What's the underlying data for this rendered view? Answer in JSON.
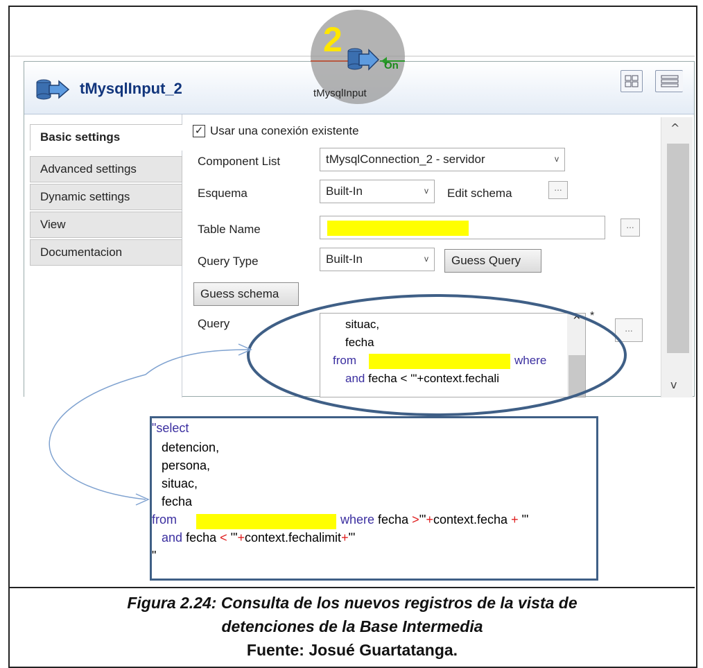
{
  "component": {
    "title": "tMysqlInput_2",
    "badge_number": "2",
    "badge_label": "tMysqlInput",
    "badge_connector": "On"
  },
  "tabs": [
    {
      "label": "Basic settings",
      "active": true
    },
    {
      "label": "Advanced settings",
      "active": false
    },
    {
      "label": "Dynamic settings",
      "active": false
    },
    {
      "label": "View",
      "active": false
    },
    {
      "label": "Documentacion",
      "active": false
    }
  ],
  "settings": {
    "use_existing_connection": {
      "label": "Usar una conexión existente",
      "checked": true
    },
    "component_list": {
      "label": "Component List",
      "value": "tMysqlConnection_2 - servidor"
    },
    "schema": {
      "label": "Esquema",
      "value": "Built-In",
      "edit_label": "Edit schema"
    },
    "table_name": {
      "label": "Table Name",
      "value": ""
    },
    "query_type": {
      "label": "Query Type",
      "value": "Built-In",
      "guess_query_label": "Guess Query"
    },
    "guess_schema_label": "Guess schema",
    "query": {
      "label": "Query",
      "modified_marker": "*",
      "visible_lines": [
        "situac,",
        "fecha",
        "from",
        "where",
        "and",
        "fecha",
        "< '\"+context.fechali"
      ]
    },
    "dots_label": "..."
  },
  "zoomed_query": {
    "lines": [
      "\"select",
      "detencion,",
      "persona,",
      "situac,",
      "fecha"
    ],
    "from_kw": "from",
    "where_kw": "where",
    "where_rest": "fecha",
    "where_op1": ">",
    "where_str1": "'\"",
    "where_op2": "+",
    "where_ctx": "context.fecha",
    "where_op3": "+",
    "where_str2": "\"'",
    "and_kw": "and",
    "and_field": "fecha",
    "and_op": "<",
    "and_str1": "'\"",
    "and_op2": "+",
    "and_ctx": "context.fechalimit",
    "and_op3": "+",
    "and_str2": "\"'",
    "closing": "\""
  },
  "caption": {
    "line1": "Figura 2.24: Consulta de los nuevos registros de la vista de",
    "line2": "detenciones de la Base Intermedia",
    "source": "Fuente: Josué Guartatanga."
  },
  "colors": {
    "highlight": "#ffff00",
    "keyword": "#3b2fa0",
    "operator": "#e02020",
    "ellipse": "#3f5f86",
    "arrow": "#7fa2d0"
  }
}
